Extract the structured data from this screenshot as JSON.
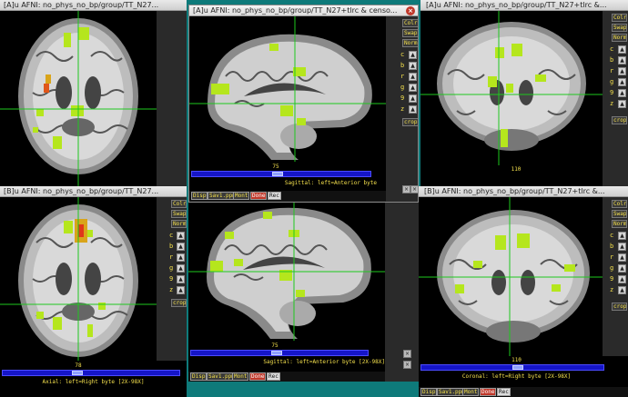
{
  "windows": {
    "axial_a": {
      "title": "[A]u AFNI: no_phys_no_bp/group/TT_N27..."
    },
    "sagittal_a": {
      "title": "[A]u AFNI: no_phys_no_bp/group/TT_N27+tlrc & censo..."
    },
    "coronal_a": {
      "title": "[A]u AFNI: no_phys_no_bp/group/TT_N27+tlrc &..."
    },
    "axial_b": {
      "title": "[B]u AFNI: no_phys_no_bp/group/TT_N27...",
      "slice": "78",
      "caption": "Axial: left=Right byte [2X-98X]"
    },
    "sagittal_b": {
      "title": "",
      "slice": "75",
      "caption": "Sagittal: left=Anterior byte [2X-98X]"
    },
    "sagittal_a_panel": {
      "slice": "75",
      "caption": "Sagittal: left=Anterior byte"
    },
    "coronal_b": {
      "title": "[B]u AFNI: no_phys_no_bp/group/TT_N27+tlrc &...",
      "slice": "110",
      "caption": "Coronal: left=Right byte [2X-98X]"
    },
    "coronal_a_panel": {
      "slice": "110"
    }
  },
  "sidebar": {
    "buttons": [
      "Colr",
      "Swap",
      "Norm"
    ],
    "keys": [
      "c",
      "b",
      "r",
      "g",
      "9",
      "z"
    ],
    "crop": "crop"
  },
  "bottom_buttons": {
    "disp": "Disp",
    "save": "Sav1.ppm",
    "mont": "Mont",
    "done": "Done",
    "rec": "Rec"
  },
  "icons": {
    "arrow": "arrow-up-icon",
    "close": "close-icon"
  }
}
